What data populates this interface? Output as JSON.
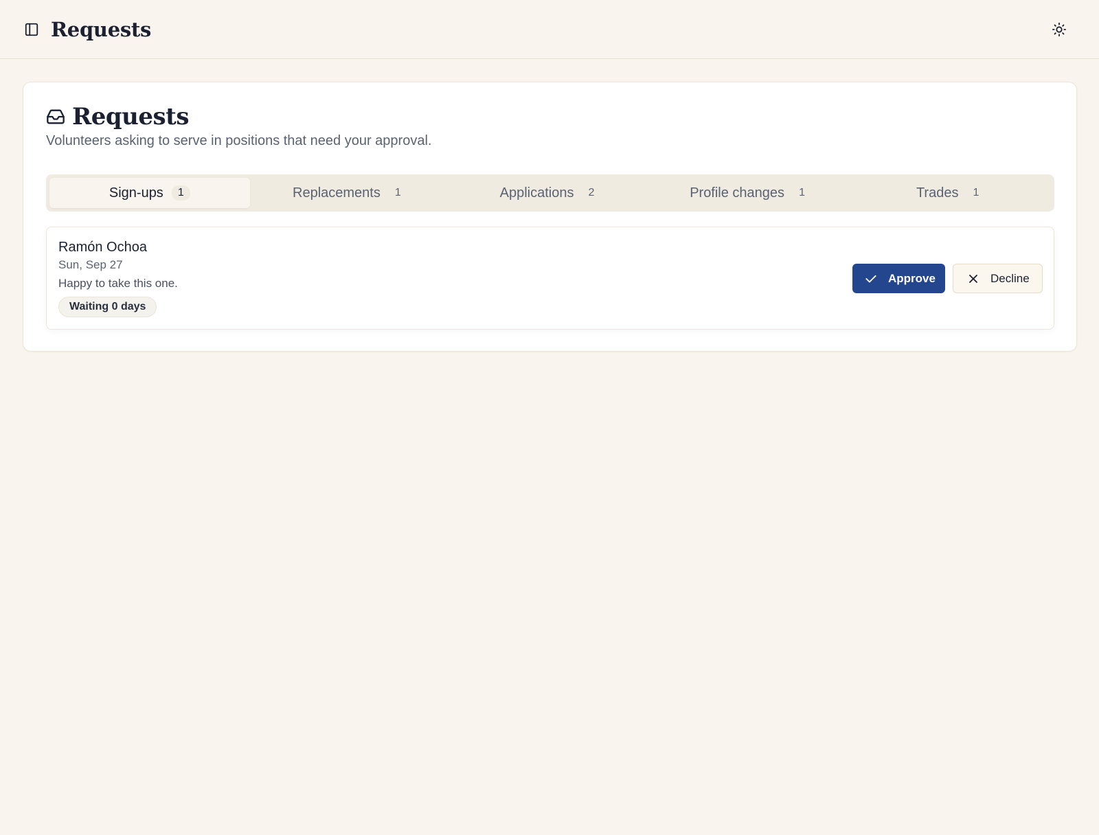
{
  "header": {
    "title": "Requests",
    "sidebar_toggle_icon": "panel-left-icon",
    "theme_toggle_icon": "sun-icon"
  },
  "card": {
    "icon": "inbox-icon",
    "title": "Requests",
    "subtitle": "Volunteers asking to serve in positions that need your approval."
  },
  "tabs": [
    {
      "label": "Sign-ups",
      "count": "1",
      "active": true
    },
    {
      "label": "Replacements",
      "count": "1",
      "active": false
    },
    {
      "label": "Applications",
      "count": "2",
      "active": false
    },
    {
      "label": "Profile changes",
      "count": "1",
      "active": false
    },
    {
      "label": "Trades",
      "count": "1",
      "active": false
    }
  ],
  "requests": [
    {
      "name": "Ramón Ochoa",
      "date": "Sun, Sep 27",
      "note": "Happy to take this one.",
      "waiting": "Waiting 0 days",
      "approve_label": "Approve",
      "decline_label": "Decline"
    }
  ],
  "colors": {
    "background": "#f9f5ee",
    "approve": "#24468f",
    "text": "#1b2130"
  }
}
